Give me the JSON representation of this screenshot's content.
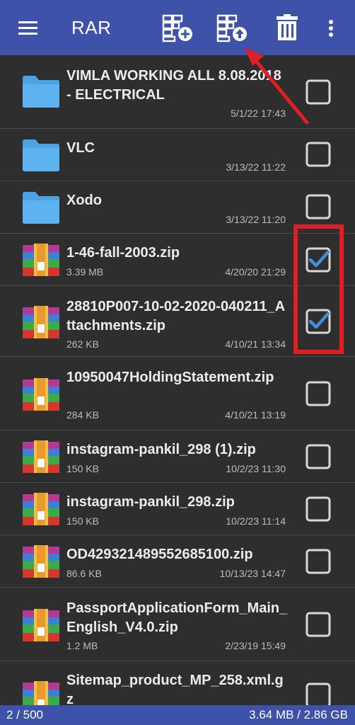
{
  "app": {
    "title": "RAR"
  },
  "toolbar": {
    "icons": [
      "menu-icon",
      "add-to-archive-icon",
      "extract-from-archive-icon",
      "delete-icon",
      "more-options-icon"
    ]
  },
  "files": [
    {
      "type": "folder",
      "name": "VIMLA WORKING ALL 8.08.2018 - ELECTRICAL",
      "size": "",
      "date": "5/1/22 17:43",
      "checked": false
    },
    {
      "type": "folder",
      "name": "VLC",
      "size": "",
      "date": "3/13/22 11:22",
      "checked": false
    },
    {
      "type": "folder",
      "name": "Xodo",
      "size": "",
      "date": "3/13/22 11:20",
      "checked": false
    },
    {
      "type": "archive",
      "name": "1-46-fall-2003.zip",
      "size": "3.39 MB",
      "date": "4/20/20 21:29",
      "checked": true
    },
    {
      "type": "archive",
      "name": "28810P007-10-02-2020-040211_Attachments.zip",
      "size": "262 KB",
      "date": "4/10/21 13:34",
      "checked": true
    },
    {
      "type": "archive",
      "name": "10950047HoldingStatement.zip",
      "size": "284 KB",
      "date": "4/10/21 13:19",
      "checked": false
    },
    {
      "type": "archive",
      "name": "instagram-pankil_298 (1).zip",
      "size": "150 KB",
      "date": "10/2/23 11:30",
      "checked": false
    },
    {
      "type": "archive",
      "name": "instagram-pankil_298.zip",
      "size": "150 KB",
      "date": "10/2/23 11:14",
      "checked": false
    },
    {
      "type": "archive",
      "name": "OD429321489552685100.zip",
      "size": "86.6 KB",
      "date": "10/13/23 14:47",
      "checked": false
    },
    {
      "type": "archive",
      "name": "PassportApplicationForm_Main_English_V4.0.zip",
      "size": "1.2 MB",
      "date": "2/23/19 15:49",
      "checked": false
    },
    {
      "type": "archive",
      "name": "Sitemap_product_MP_258.xml.gz",
      "size": "",
      "date": "",
      "checked": false
    }
  ],
  "status": {
    "selection": "2 / 500",
    "sizes": "3.64 MB / 2.86 GB"
  },
  "colors": {
    "toolbar": "#3d52a8",
    "background": "#2e2e2e",
    "folder": "#4aa3e6",
    "checkbox_checked": "#3f8fd8",
    "annotation_red": "#e21d24"
  }
}
